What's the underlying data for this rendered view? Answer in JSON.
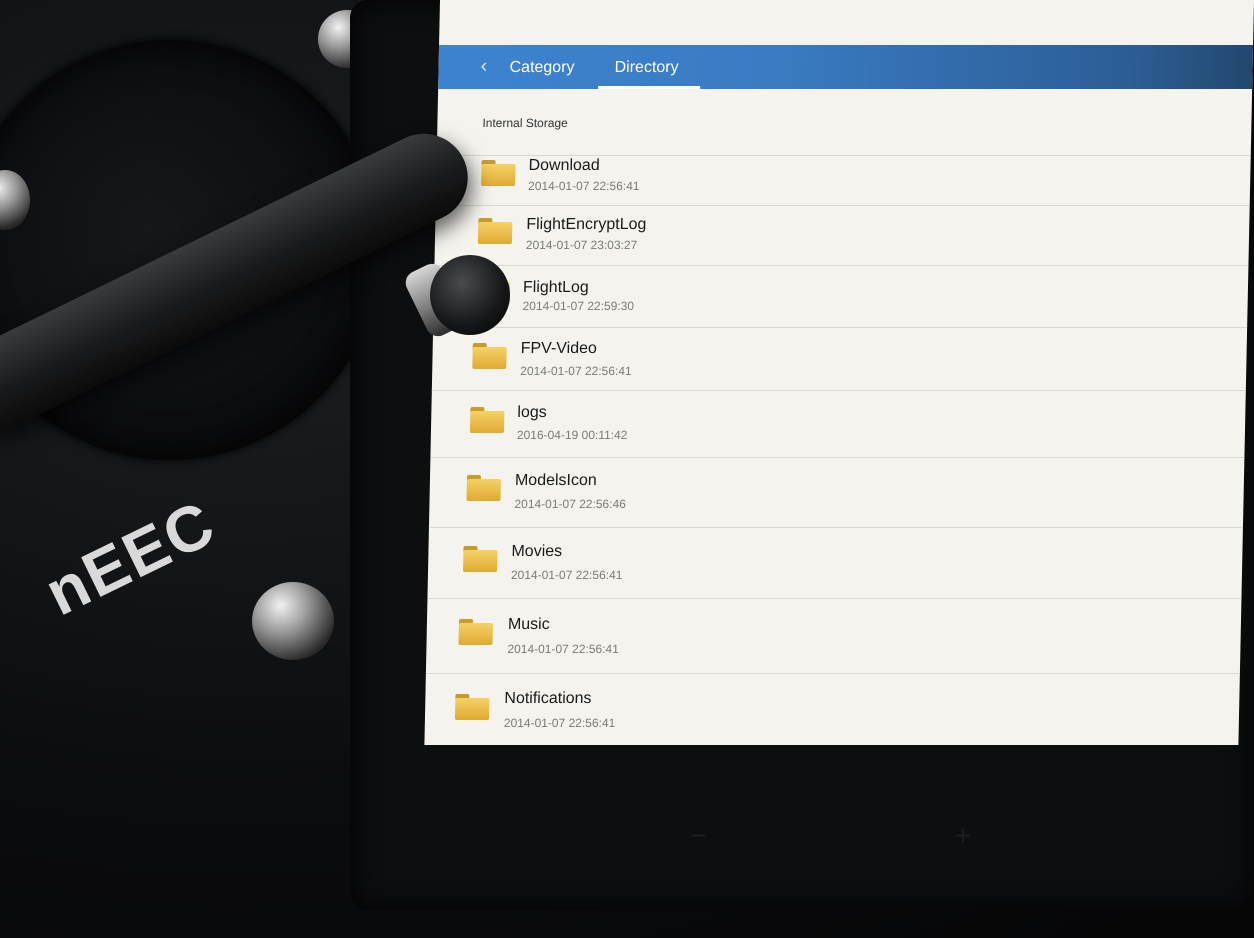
{
  "header": {
    "back_icon": "chevron-left-icon",
    "tabs": [
      {
        "label": "Category",
        "active": false
      },
      {
        "label": "Directory",
        "active": true
      }
    ]
  },
  "path_label": "Internal Storage",
  "folders": [
    {
      "name": "Download",
      "date": "2014-01-07 22:56:41"
    },
    {
      "name": "FlightEncryptLog",
      "date": "2014-01-07 23:03:27"
    },
    {
      "name": "FlightLog",
      "date": "2014-01-07 22:59:30"
    },
    {
      "name": "FPV-Video",
      "date": "2014-01-07 22:56:41"
    },
    {
      "name": "logs",
      "date": "2016-04-19 00:11:42"
    },
    {
      "name": "ModelsIcon",
      "date": "2014-01-07 22:56:46"
    },
    {
      "name": "Movies",
      "date": "2014-01-07 22:56:41"
    },
    {
      "name": "Music",
      "date": "2014-01-07 22:56:41"
    },
    {
      "name": "Notifications",
      "date": "2014-01-07 22:56:41"
    }
  ],
  "colors": {
    "topbar": "#3a7cc4",
    "list_background": "#f4f3ee",
    "folder_icon": "#f1c04a"
  },
  "device": {
    "stylus_brand": "nEEC",
    "buttons": [
      "−",
      "+"
    ]
  }
}
